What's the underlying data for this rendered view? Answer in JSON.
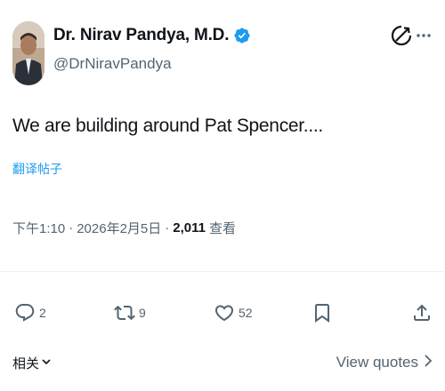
{
  "author": {
    "display_name": "Dr. Nirav Pandya, M.D.",
    "handle": "@DrNiravPandya",
    "verified": true
  },
  "post": {
    "text": "We are building around Pat Spencer....",
    "translate_label": "翻译帖子",
    "time": "下午1:10",
    "separator1": "·",
    "date": "2026年2月5日",
    "separator2": "·",
    "views_count": "2,011",
    "views_label": "查看"
  },
  "actions": {
    "reply_count": "2",
    "repost_count": "9",
    "like_count": "52"
  },
  "footer": {
    "related_label": "相关",
    "view_quotes_label": "View quotes"
  },
  "colors": {
    "accent": "#1d9bf0",
    "muted": "#536471",
    "text": "#0f1419"
  },
  "icons": [
    "verified-badge-icon",
    "grok-icon",
    "more-options-icon",
    "reply-icon",
    "repost-icon",
    "like-icon",
    "bookmark-icon",
    "share-icon",
    "chevron-down-icon",
    "chevron-right-icon"
  ]
}
